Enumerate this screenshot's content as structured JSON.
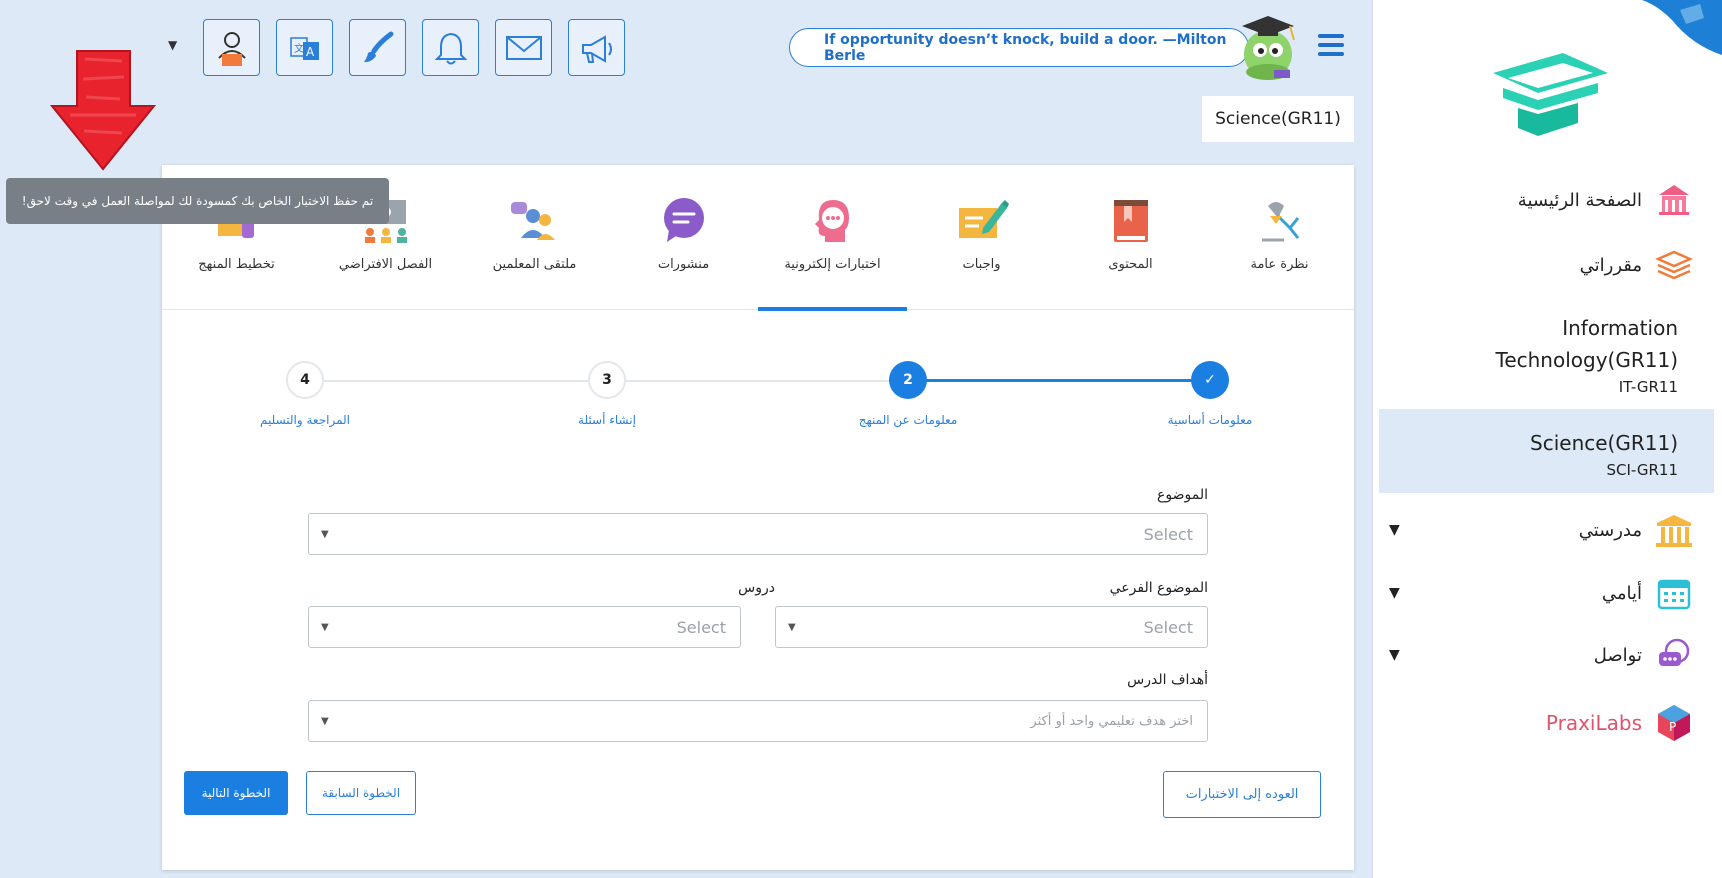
{
  "topbar": {
    "icons": [
      "profile-icon",
      "translate-icon",
      "brush-icon",
      "bell-icon",
      "mail-icon",
      "megaphone-icon"
    ],
    "quote": "If opportunity doesn’t knock, build a door. —Milton Berle",
    "course_badge": "Science(GR11)"
  },
  "tooltip": {
    "text": "!تم حفظ الاختبار الخاص بك كمسودة لك لمواصلة العمل في وقت لاحق"
  },
  "sidebar": {
    "home": "الصفحة الرئيسية",
    "my_courses": "مقرراتي",
    "courses": [
      {
        "title_line1": "Information",
        "title_line2": "Technology(GR11)",
        "code": "IT-GR11"
      },
      {
        "title_line1": "Science(GR11)",
        "code": "SCI-GR11"
      }
    ],
    "my_school": "مدرستي",
    "my_days": "أيامي",
    "communication": "تواصل",
    "praxilabs": "PraxiLabs"
  },
  "tabs": [
    {
      "label": "نظرة عامة",
      "icon": "lamp-icon",
      "color": "#5aa9d6"
    },
    {
      "label": "المحتوى",
      "icon": "book-icon",
      "color": "#e8634a"
    },
    {
      "label": "واجبات",
      "icon": "assignment-icon",
      "color": "#f4b63f"
    },
    {
      "label": "اختبارات إلكترونية",
      "icon": "quiz-head-icon",
      "color": "#ee6d8f"
    },
    {
      "label": "منشورات",
      "icon": "chat-bubble-icon",
      "color": "#8a5bc9"
    },
    {
      "label": "ملتقى المعلمين",
      "icon": "teachers-icon",
      "color": "#5a8fd8"
    },
    {
      "label": "الفصل الافتراضي",
      "icon": "virtual-class-icon",
      "color": "#4fb3a0"
    },
    {
      "label": "تخطيط المنهج",
      "icon": "curriculum-icon",
      "color": "#a36bd1"
    }
  ],
  "stepper": {
    "steps": [
      {
        "label": "معلومات أساسية",
        "num": "✓"
      },
      {
        "label": "معلومات عن المنهج",
        "num": "2"
      },
      {
        "label": "إنشاء أسئلة",
        "num": "3"
      },
      {
        "label": "المراجعة والتسليم",
        "num": "4"
      }
    ]
  },
  "form": {
    "topic_label": "الموضوع",
    "topic_placeholder": "Select",
    "subtopic_label": "الموضوع الفرعي",
    "subtopic_placeholder": "Select",
    "lessons_label": "دروس",
    "lessons_placeholder": "Select",
    "objectives_label": "أهداف الدرس",
    "objectives_placeholder": "اختر هدف تعليمي واحد أو أكثر"
  },
  "buttons": {
    "back_to_quizzes": "العوده إلى الاختبارات",
    "previous_step": "الخطوة السابقة",
    "next_step": "الخطوة التالية"
  },
  "colors": {
    "accent": "#1a7fe0",
    "page_bg": "#dde9f6"
  }
}
